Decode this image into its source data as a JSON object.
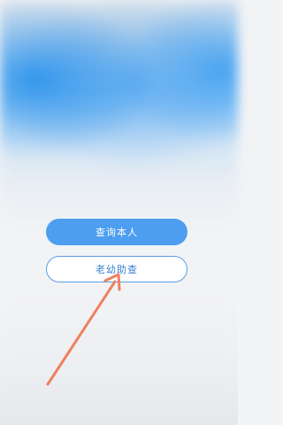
{
  "buttons": {
    "query_self_label": "查询本人",
    "elder_child_label": "老幼助查"
  },
  "annotation": {
    "arrow_color": "#f07f5e"
  },
  "colors": {
    "primary_button": "#4d9df0",
    "secondary_button_text": "#3b7fd0",
    "secondary_button_border": "#5a9ee6"
  }
}
